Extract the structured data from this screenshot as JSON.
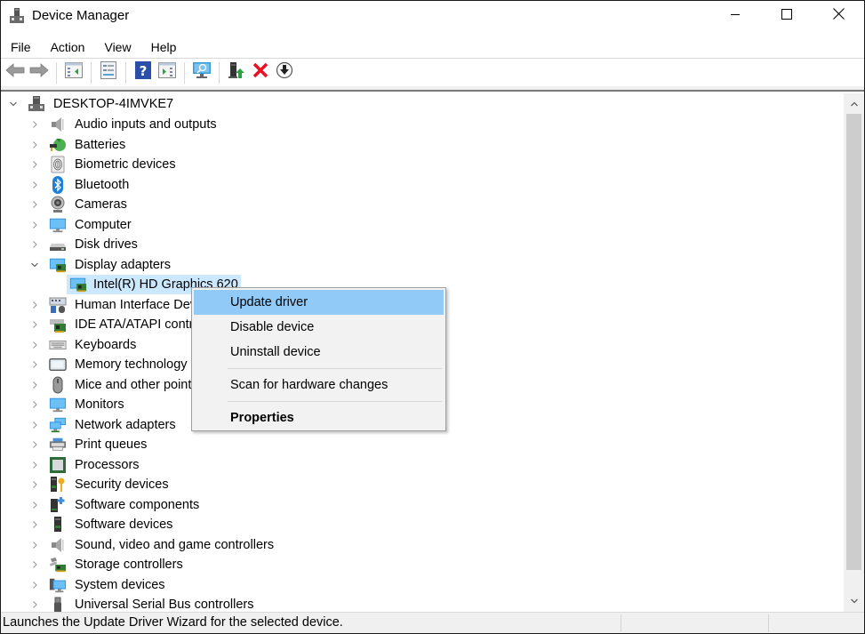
{
  "window": {
    "title": "Device Manager",
    "controls": {
      "minimize": "minimize",
      "maximize": "maximize",
      "close": "close"
    }
  },
  "menubar": {
    "items": [
      {
        "label": "File"
      },
      {
        "label": "Action"
      },
      {
        "label": "View"
      },
      {
        "label": "Help"
      }
    ]
  },
  "toolbar": {
    "buttons": [
      {
        "icon": "back-arrow-icon",
        "tooltip": "Back"
      },
      {
        "icon": "forward-arrow-icon",
        "tooltip": "Forward"
      },
      {
        "icon": "show-hide-console-tree-icon",
        "tooltip": "Show/Hide Console Tree"
      },
      {
        "icon": "properties-icon",
        "tooltip": "Properties"
      },
      {
        "icon": "help-icon",
        "tooltip": "Help"
      },
      {
        "icon": "show-hide-action-pane-icon",
        "tooltip": "Show/Hide Action Pane"
      },
      {
        "icon": "scan-hardware-icon",
        "tooltip": "Scan for hardware changes"
      },
      {
        "icon": "update-driver-icon",
        "tooltip": "Update driver"
      },
      {
        "icon": "uninstall-icon",
        "tooltip": "Uninstall device"
      },
      {
        "icon": "disable-device-icon",
        "tooltip": "Disable device"
      }
    ]
  },
  "tree": {
    "root": {
      "label": "DESKTOP-4IMVKE7",
      "expanded": true
    },
    "categories": [
      {
        "label": "Audio inputs and outputs",
        "icon": "speaker-icon",
        "expanded": false
      },
      {
        "label": "Batteries",
        "icon": "battery-icon",
        "expanded": false
      },
      {
        "label": "Biometric devices",
        "icon": "fingerprint-icon",
        "expanded": false
      },
      {
        "label": "Bluetooth",
        "icon": "bluetooth-icon",
        "expanded": false
      },
      {
        "label": "Cameras",
        "icon": "webcam-icon",
        "expanded": false
      },
      {
        "label": "Computer",
        "icon": "computer-monitor-icon",
        "expanded": false
      },
      {
        "label": "Disk drives",
        "icon": "disk-drive-icon",
        "expanded": false
      },
      {
        "label": "Display adapters",
        "icon": "display-adapter-icon",
        "expanded": true,
        "children": [
          {
            "label": "Intel(R) HD Graphics 620",
            "icon": "display-adapter-icon",
            "selected": true
          }
        ]
      },
      {
        "label": "Human Interface Devices",
        "icon": "hid-icon",
        "expanded": false
      },
      {
        "label": "IDE ATA/ATAPI controllers",
        "icon": "ide-controller-icon",
        "expanded": false
      },
      {
        "label": "Keyboards",
        "icon": "keyboard-icon",
        "expanded": false
      },
      {
        "label": "Memory technology devices",
        "icon": "memory-icon",
        "expanded": false
      },
      {
        "label": "Mice and other pointing devices",
        "icon": "mouse-icon",
        "expanded": false
      },
      {
        "label": "Monitors",
        "icon": "monitor-icon",
        "expanded": false
      },
      {
        "label": "Network adapters",
        "icon": "network-icon",
        "expanded": false
      },
      {
        "label": "Print queues",
        "icon": "printer-icon",
        "expanded": false
      },
      {
        "label": "Processors",
        "icon": "processor-icon",
        "expanded": false
      },
      {
        "label": "Security devices",
        "icon": "security-key-icon",
        "expanded": false
      },
      {
        "label": "Software components",
        "icon": "software-component-icon",
        "expanded": false
      },
      {
        "label": "Software devices",
        "icon": "software-device-icon",
        "expanded": false
      },
      {
        "label": "Sound, video and game controllers",
        "icon": "speaker-icon",
        "expanded": false
      },
      {
        "label": "Storage controllers",
        "icon": "storage-controller-icon",
        "expanded": false
      },
      {
        "label": "System devices",
        "icon": "system-devices-icon",
        "expanded": false
      },
      {
        "label": "Universal Serial Bus controllers",
        "icon": "usb-icon",
        "expanded": false
      }
    ]
  },
  "context_menu": {
    "items": [
      {
        "label": "Update driver",
        "highlighted": true
      },
      {
        "label": "Disable device"
      },
      {
        "label": "Uninstall device"
      },
      {
        "separator": true
      },
      {
        "label": "Scan for hardware changes"
      },
      {
        "separator": true
      },
      {
        "label": "Properties",
        "bold": true
      }
    ]
  },
  "statusbar": {
    "text": "Launches the Update Driver Wizard for the selected device."
  },
  "colors": {
    "selection": "#cce8ff",
    "menu_highlight": "#91c9f7",
    "menu_bg": "#f2f2f2",
    "uninstall_red": "#e81123"
  }
}
